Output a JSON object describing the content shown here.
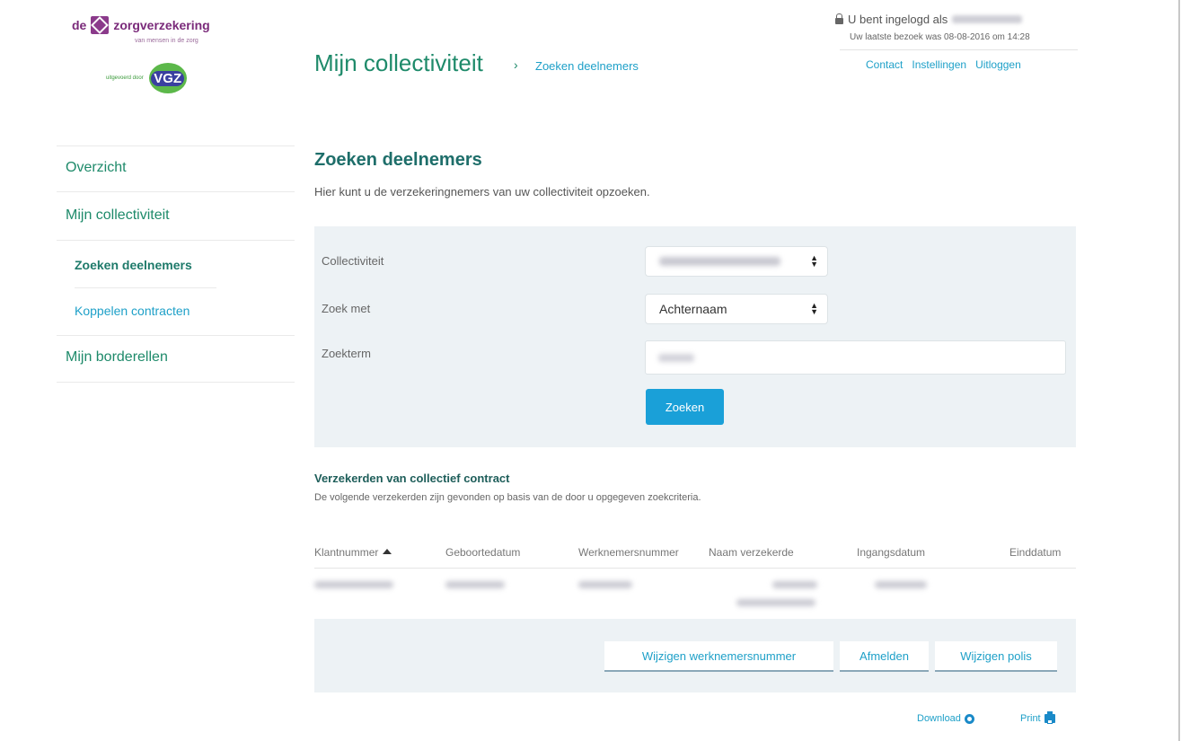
{
  "brand": {
    "name": "zorgverzekering",
    "prefix": "de",
    "tagline": "van mensen in de zorg",
    "partner_caption": "uitgevoerd door",
    "partner_logo": "VGZ",
    "brand_color": "#8b3a8b",
    "partner_color": "#5cb84a"
  },
  "header": {
    "title": "Mijn collectiviteit",
    "breadcrumb_current": "Zoeken deelnemers",
    "login_text": "U bent ingelogd als",
    "last_visit": "Uw laatste bezoek was 08-08-2016 om 14:28",
    "links": [
      "Contact",
      "Instellingen",
      "Uitloggen"
    ]
  },
  "sidebar": {
    "items": [
      {
        "label": "Overzicht"
      },
      {
        "label": "Mijn collectiviteit"
      },
      {
        "label": "Zoeken deelnemers",
        "active": true
      },
      {
        "label": "Koppelen contracten"
      },
      {
        "label": "Mijn borderellen"
      }
    ]
  },
  "main": {
    "heading": "Zoeken deelnemers",
    "intro": "Hier kunt u de verzekeringnemers van uw collectiviteit opzoeken.",
    "form": {
      "collectiviteit_label": "Collectiviteit",
      "zoek_met_label": "Zoek met",
      "zoek_met_value": "Achternaam",
      "zoekterm_label": "Zoekterm",
      "search_button": "Zoeken"
    },
    "results": {
      "heading": "Verzekerden van collectief contract",
      "subtext": "De volgende verzekerden zijn gevonden op basis van de door u opgegeven zoekcriteria.",
      "columns": [
        "Klantnummer",
        "Geboortedatum",
        "Werknemersnummer",
        "Naam verzekerde",
        "Ingangsdatum",
        "Einddatum"
      ]
    },
    "actions": [
      "Wijzigen werknemersnummer",
      "Afmelden",
      "Wijzigen polis"
    ],
    "footer": {
      "download": "Download",
      "print": "Print"
    }
  },
  "colors": {
    "accent_green": "#1e8a6a",
    "link_blue": "#1ea0c8",
    "primary_button": "#1aa0d8",
    "panel_bg": "#edf2f5"
  }
}
